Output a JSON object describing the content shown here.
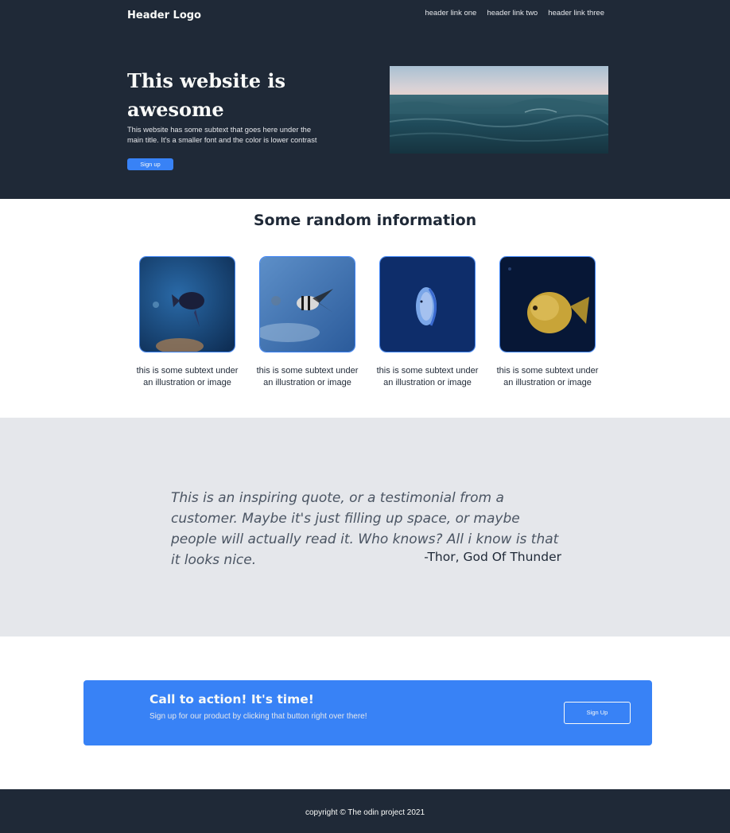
{
  "header": {
    "logo": "Header Logo",
    "links": [
      "header link one",
      "header link two",
      "header link three"
    ]
  },
  "hero": {
    "title": "This website is awesome",
    "subtext": "This website has some subtext that goes here under the main title. It's a smaller font and the color is lower contrast",
    "button_label": "Sign up",
    "image_icon": "ocean-wave-image"
  },
  "info": {
    "title": "Some random information",
    "cards": [
      {
        "image_icon": "dark-fish-image",
        "text": "this is some subtext under an illustration or image"
      },
      {
        "image_icon": "striped-fish-image",
        "text": "this is some subtext under an illustration or image"
      },
      {
        "image_icon": "blue-discus-image",
        "text": "this is some subtext under an illustration or image"
      },
      {
        "image_icon": "yellow-fish-image",
        "text": "this is some subtext under an illustration or image"
      }
    ]
  },
  "quote": {
    "text": "This is an inspiring quote, or a testimonial from a customer. Maybe it's just filling up space, or maybe people will actually read it. Who knows? All i know is that it looks nice.",
    "author": "-Thor, God Of Thunder"
  },
  "cta": {
    "title": "Call to action! It's time!",
    "subtext": "Sign up for our product by clicking that button right over there!",
    "button_label": "Sign Up"
  },
  "footer": {
    "text": "copyright © The odin project 2021"
  },
  "colors": {
    "dark": "#1f2937",
    "accent": "#3882f6",
    "light": "#f9faf8",
    "gray": "#e5e7eb"
  }
}
